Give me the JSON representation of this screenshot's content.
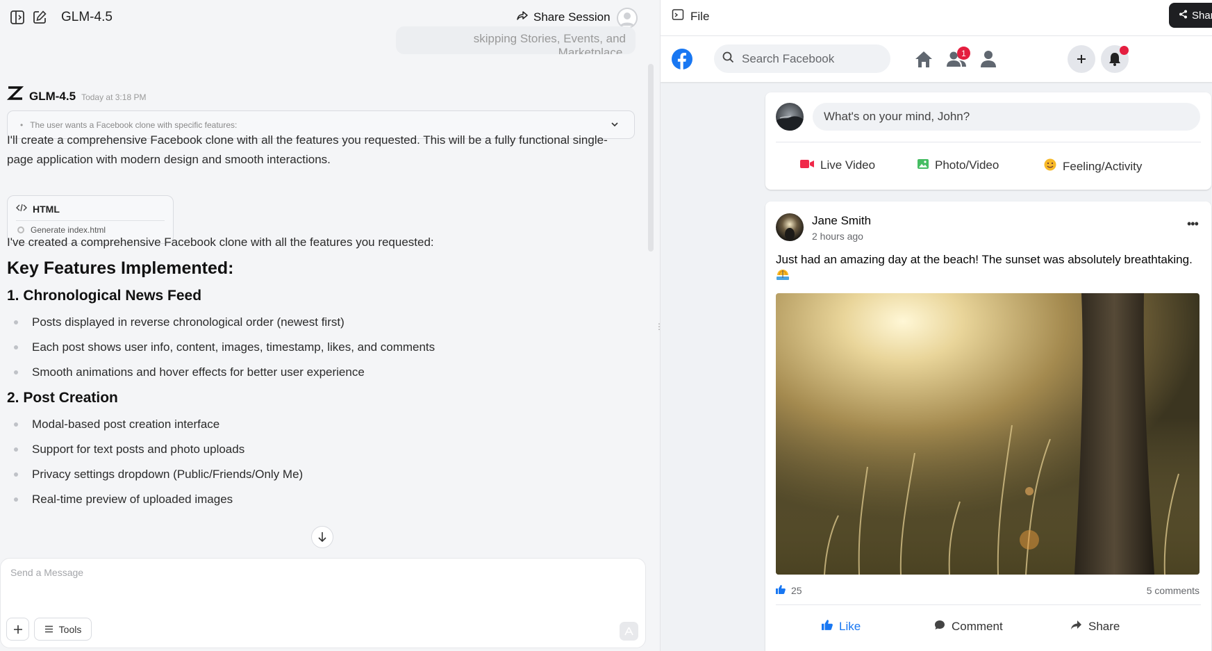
{
  "chat": {
    "model_title": "GLM-4.5",
    "share_session_label": "Share Session",
    "user_message_tail": "skipping Stories, Events, and Marketplace.",
    "assistant": {
      "name": "GLM-4.5",
      "time": "Today at 3:18 PM",
      "thinking_summary": "The user wants a Facebook clone with specific features:",
      "intro": "I'll create a comprehensive Facebook clone with all the features you requested. This will be a fully functional single-page application with modern design and smooth interactions.",
      "artifact": {
        "title": "HTML",
        "action": "Generate index.html"
      },
      "summary": "I've created a comprehensive Facebook clone with all the features you requested:",
      "heading": "Key Features Implemented:",
      "sections": [
        {
          "title": "1. Chronological News Feed",
          "items": [
            "Posts displayed in reverse chronological order (newest first)",
            "Each post shows user info, content, images, timestamp, likes, and comments",
            "Smooth animations and hover effects for better user experience"
          ]
        },
        {
          "title": "2. Post Creation",
          "items": [
            "Modal-based post creation interface",
            "Support for text posts and photo uploads",
            "Privacy settings dropdown (Public/Friends/Only Me)",
            "Real-time preview of uploaded images"
          ]
        }
      ]
    },
    "composer": {
      "placeholder": "Send a Message",
      "tools_label": "Tools"
    }
  },
  "preview": {
    "file_label": "File",
    "share_label": "Shar",
    "nav": {
      "search_placeholder": "Search Facebook",
      "friends_badge": "1"
    },
    "composer": {
      "prompt": "What's on your mind, John?",
      "actions": [
        "Live Video",
        "Photo/Video",
        "Feeling/Activity"
      ]
    },
    "post": {
      "author": "Jane Smith",
      "time": "2 hours ago",
      "text": "Just had an amazing day at the beach! The sunset was absolutely breathtaking.",
      "likes": "25",
      "comments": "5 comments",
      "actions": [
        "Like",
        "Comment",
        "Share"
      ]
    }
  },
  "colors": {
    "facebook_blue": "#1877f2",
    "badge_red": "#e41e3f",
    "live_red": "#f02849",
    "photo_green": "#45bd62",
    "feeling_yellow": "#f7b928"
  }
}
